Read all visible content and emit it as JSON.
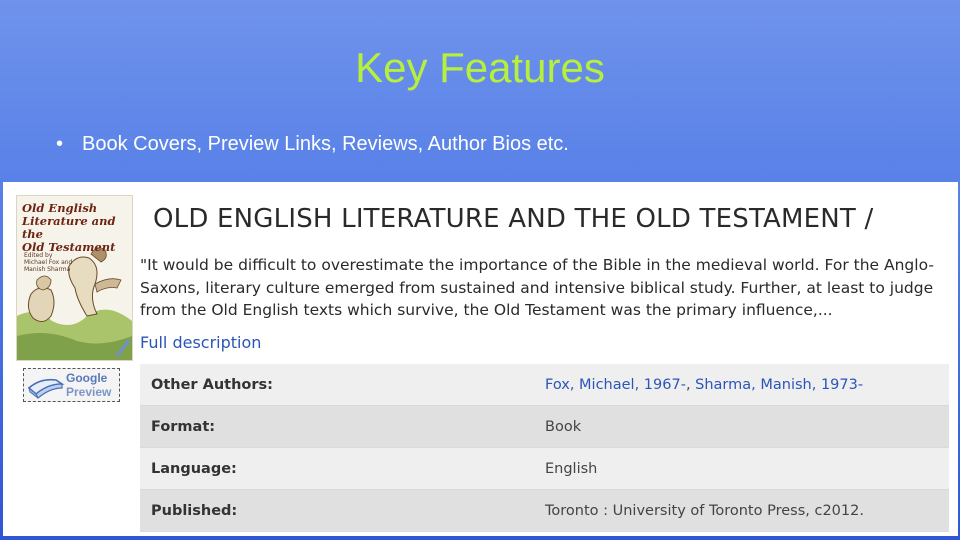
{
  "slide": {
    "title": "Key Features",
    "bullet": "Book Covers, Preview Links, Reviews, Author Bios etc."
  },
  "record": {
    "cover": {
      "title_line1": "Old English",
      "title_line2": "Literature and the",
      "title_line3": "Old Testament",
      "editors_line1": "Edited by",
      "editors_line2": "Michael Fox and",
      "editors_line3": "Manish Sharma"
    },
    "preview_button": {
      "line1": "Google",
      "line2": "Preview"
    },
    "title": "OLD ENGLISH LITERATURE AND THE OLD TESTAMENT /",
    "summary": "\"It would be difficult to overestimate the importance of the Bible in the medieval world. For the Anglo-Saxons, literary culture emerged from sustained and intensive biblical study. Further, at least to judge from the Old English texts which survive, the Old Testament was the primary influence,...",
    "full_description_link": "Full description",
    "details": {
      "other_authors": {
        "label": "Other Authors:",
        "author1": "Fox, Michael, 1967-",
        "separator": ",",
        "author2": "Sharma, Manish, 1973-"
      },
      "format": {
        "label": "Format:",
        "value": "Book"
      },
      "language": {
        "label": "Language:",
        "value": "English"
      },
      "published": {
        "label": "Published:",
        "value": "Toronto : University of Toronto Press, c2012."
      }
    }
  },
  "colors": {
    "title_green": "#b7f03c",
    "link_blue": "#2b55b8",
    "background_blue": "#4a75e4"
  }
}
